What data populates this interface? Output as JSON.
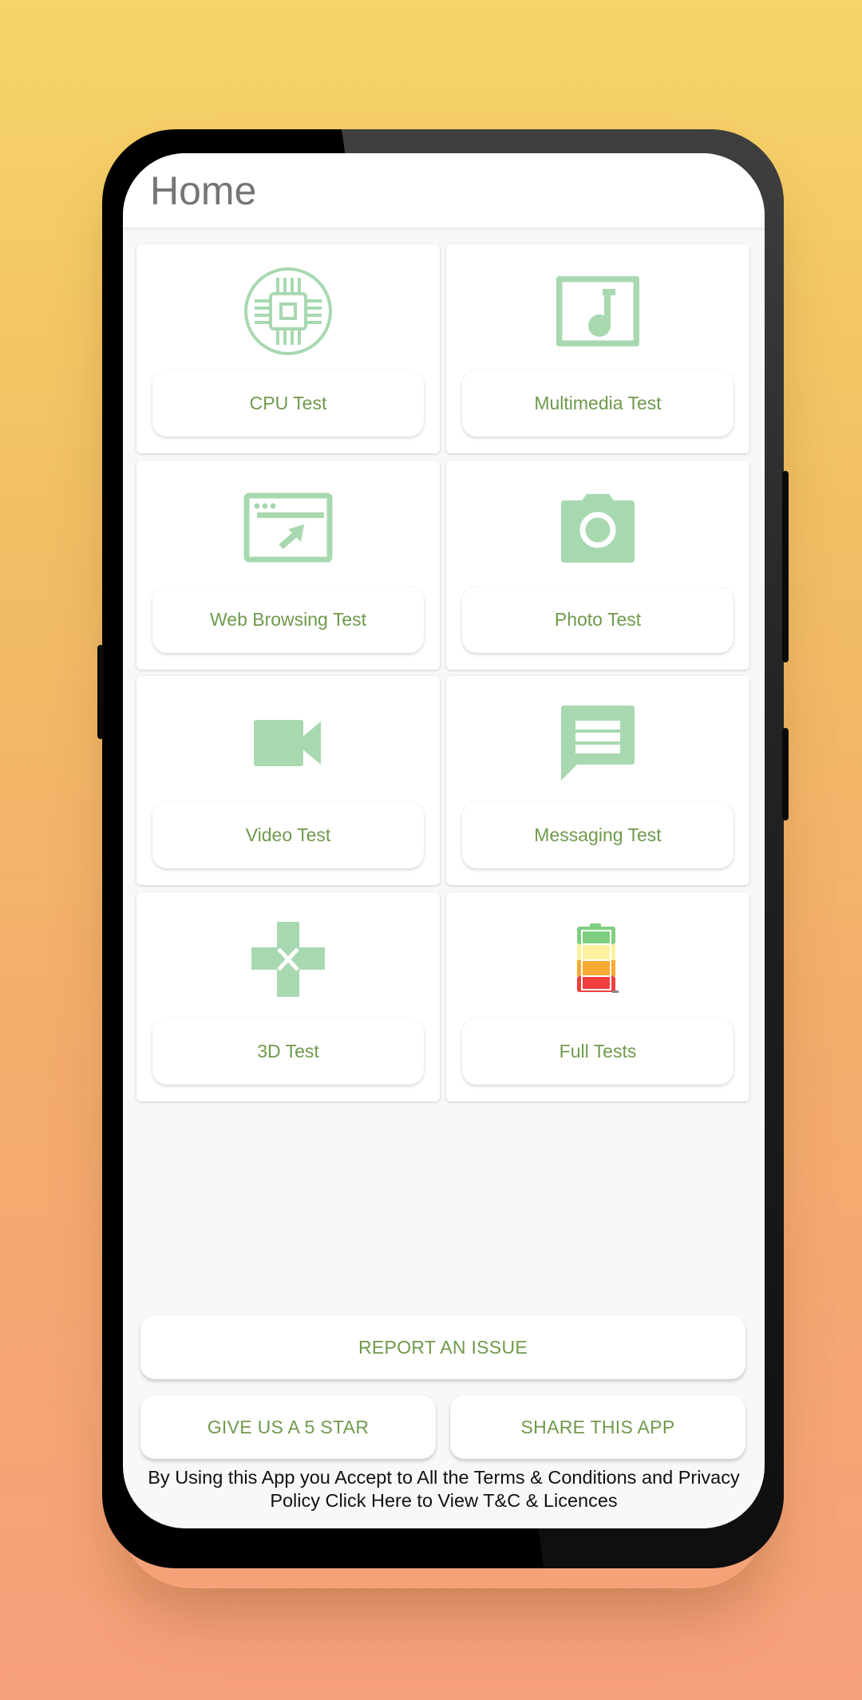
{
  "app": {
    "title": "Home"
  },
  "colors": {
    "accent_text": "#6f9a4c",
    "icon_green": "#a8d8b0",
    "title_gray": "#757575",
    "background_top": "#f6d468",
    "background_bottom": "#f7a07c"
  },
  "tests": [
    {
      "label": "CPU Test",
      "icon": "cpu-chip-icon"
    },
    {
      "label": "Multimedia Test",
      "icon": "music-note-icon"
    },
    {
      "label": "Web Browsing Test",
      "icon": "browser-window-icon"
    },
    {
      "label": "Photo Test",
      "icon": "camera-icon"
    },
    {
      "label": "Video Test",
      "icon": "video-camera-icon"
    },
    {
      "label": "Messaging Test",
      "icon": "message-bubble-icon"
    },
    {
      "label": "3D Test",
      "icon": "gamepad-dpad-icon"
    },
    {
      "label": "Full Tests",
      "icon": "battery-levels-icon"
    }
  ],
  "actions": {
    "report_issue": "REPORT AN ISSUE",
    "rate": "GIVE US A 5 STAR",
    "share": "SHARE THIS APP"
  },
  "footer": {
    "terms_text": "By Using this App you Accept to All the Terms & Conditions and Privacy Policy Click Here to View T&C & Licences"
  }
}
